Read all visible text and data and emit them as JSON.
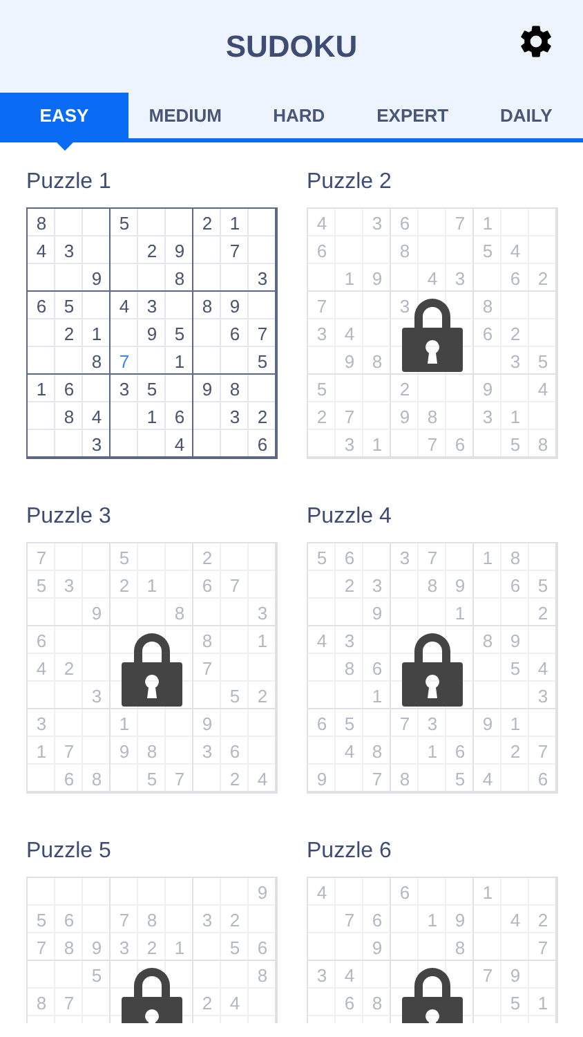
{
  "title": "SUDOKU",
  "tabs": [
    {
      "label": "EASY",
      "selected": true
    },
    {
      "label": "MEDIUM",
      "selected": false
    },
    {
      "label": "HARD",
      "selected": false
    },
    {
      "label": "EXPERT",
      "selected": false
    },
    {
      "label": "DAILY",
      "selected": false
    }
  ],
  "puzzles": [
    {
      "title": "Puzzle 1",
      "locked": false,
      "rows": [
        [
          "8",
          null,
          null,
          "5",
          null,
          null,
          "2",
          "1",
          null
        ],
        [
          "4",
          "3",
          null,
          null,
          "2",
          "9",
          null,
          "7",
          null
        ],
        [
          null,
          null,
          "9",
          null,
          null,
          "8",
          null,
          null,
          "3"
        ],
        [
          "6",
          "5",
          null,
          "4",
          "3",
          null,
          "8",
          "9",
          null
        ],
        [
          null,
          "2",
          "1",
          null,
          "9",
          "5",
          null,
          "6",
          "7"
        ],
        [
          null,
          null,
          "8",
          {
            "digit": "7",
            "entered": true
          },
          null,
          "1",
          null,
          null,
          "5"
        ],
        [
          "1",
          "6",
          null,
          "3",
          "5",
          null,
          "9",
          "8",
          null
        ],
        [
          null,
          "8",
          "4",
          null,
          "1",
          "6",
          null,
          "3",
          "2"
        ],
        [
          null,
          null,
          "3",
          null,
          null,
          "4",
          null,
          null,
          "6"
        ]
      ]
    },
    {
      "title": "Puzzle 2",
      "locked": true,
      "rows": [
        [
          "4",
          null,
          "3",
          "6",
          null,
          "7",
          "1",
          null,
          null
        ],
        [
          "6",
          null,
          null,
          "8",
          null,
          null,
          "5",
          "4",
          null
        ],
        [
          null,
          "1",
          "9",
          null,
          "4",
          "3",
          null,
          "6",
          "2"
        ],
        [
          "7",
          null,
          null,
          "3",
          null,
          null,
          "8",
          null,
          null
        ],
        [
          "3",
          "4",
          null,
          null,
          null,
          null,
          "6",
          "2",
          null
        ],
        [
          null,
          "9",
          "8",
          null,
          null,
          null,
          null,
          "3",
          "5"
        ],
        [
          "5",
          null,
          null,
          "2",
          null,
          null,
          "9",
          null,
          "4"
        ],
        [
          "2",
          "7",
          null,
          "9",
          "8",
          null,
          "3",
          "1",
          null
        ],
        [
          null,
          "3",
          "1",
          null,
          "7",
          "6",
          null,
          "5",
          "8"
        ]
      ]
    },
    {
      "title": "Puzzle 3",
      "locked": true,
      "rows": [
        [
          "7",
          null,
          null,
          "5",
          null,
          null,
          "2",
          null,
          null
        ],
        [
          "5",
          "3",
          null,
          "2",
          "1",
          null,
          "6",
          "7",
          null
        ],
        [
          null,
          null,
          "9",
          null,
          null,
          "8",
          null,
          null,
          "3"
        ],
        [
          "6",
          null,
          null,
          null,
          null,
          null,
          "8",
          null,
          "1"
        ],
        [
          "4",
          "2",
          null,
          null,
          null,
          null,
          "7",
          null,
          null
        ],
        [
          null,
          null,
          "3",
          null,
          null,
          null,
          null,
          "5",
          "2"
        ],
        [
          "3",
          null,
          null,
          "1",
          null,
          null,
          "9",
          null,
          null
        ],
        [
          "1",
          "7",
          null,
          "9",
          "8",
          null,
          "3",
          "6",
          null
        ],
        [
          null,
          "6",
          "8",
          null,
          "5",
          "7",
          null,
          "2",
          "4"
        ]
      ]
    },
    {
      "title": "Puzzle 4",
      "locked": true,
      "rows": [
        [
          "5",
          "6",
          null,
          "3",
          "7",
          null,
          "1",
          "8",
          null
        ],
        [
          null,
          "2",
          "3",
          null,
          "8",
          "9",
          null,
          "6",
          "5"
        ],
        [
          null,
          null,
          "9",
          null,
          null,
          "1",
          null,
          null,
          "2"
        ],
        [
          "4",
          "3",
          null,
          null,
          null,
          null,
          "8",
          "9",
          null
        ],
        [
          null,
          "8",
          "6",
          null,
          null,
          null,
          null,
          "5",
          "4"
        ],
        [
          null,
          null,
          "1",
          null,
          null,
          null,
          null,
          null,
          "3"
        ],
        [
          "6",
          "5",
          null,
          "7",
          "3",
          null,
          "9",
          "1",
          null
        ],
        [
          null,
          "4",
          "8",
          null,
          "1",
          "6",
          null,
          "2",
          "7"
        ],
        [
          "9",
          null,
          "7",
          "8",
          null,
          "5",
          "4",
          null,
          "6"
        ]
      ]
    },
    {
      "title": "Puzzle 5",
      "locked": true,
      "rows": [
        [
          null,
          null,
          null,
          null,
          null,
          null,
          null,
          null,
          "9"
        ],
        [
          "5",
          "6",
          null,
          "7",
          "8",
          null,
          "3",
          "2",
          null
        ],
        [
          "7",
          "8",
          "9",
          "3",
          "2",
          "1",
          null,
          "5",
          "6"
        ],
        [
          null,
          null,
          "5",
          null,
          null,
          null,
          null,
          null,
          "8"
        ],
        [
          "8",
          "7",
          null,
          null,
          null,
          null,
          "2",
          "4",
          null
        ]
      ]
    },
    {
      "title": "Puzzle 6",
      "locked": true,
      "rows": [
        [
          "4",
          null,
          null,
          "6",
          null,
          null,
          "1",
          null,
          null
        ],
        [
          null,
          "7",
          "6",
          null,
          "1",
          "9",
          null,
          "4",
          "2"
        ],
        [
          null,
          null,
          "9",
          null,
          null,
          "8",
          null,
          null,
          "7"
        ],
        [
          "3",
          "4",
          null,
          null,
          null,
          null,
          "7",
          "9",
          null
        ],
        [
          null,
          "6",
          "8",
          null,
          null,
          null,
          null,
          "5",
          "1"
        ]
      ]
    }
  ]
}
